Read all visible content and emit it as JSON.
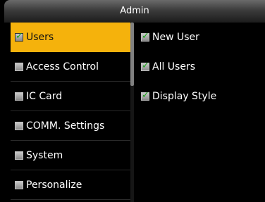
{
  "title": "Admin",
  "left_menu": [
    {
      "label": "Users",
      "checked": true,
      "selected": true
    },
    {
      "label": "Access Control",
      "checked": false,
      "selected": false
    },
    {
      "label": "IC Card",
      "checked": false,
      "selected": false
    },
    {
      "label": "COMM. Settings",
      "checked": false,
      "selected": false
    },
    {
      "label": "System",
      "checked": false,
      "selected": false
    },
    {
      "label": "Personalize",
      "checked": false,
      "selected": false
    }
  ],
  "right_menu": [
    {
      "label": "New User",
      "checked": true
    },
    {
      "label": "All Users",
      "checked": true
    },
    {
      "label": "Display Style",
      "checked": true
    }
  ],
  "colors": {
    "accent": "#f5b20c",
    "check": "#1aa51a"
  },
  "icons": {
    "check": "checkbox-icon"
  }
}
